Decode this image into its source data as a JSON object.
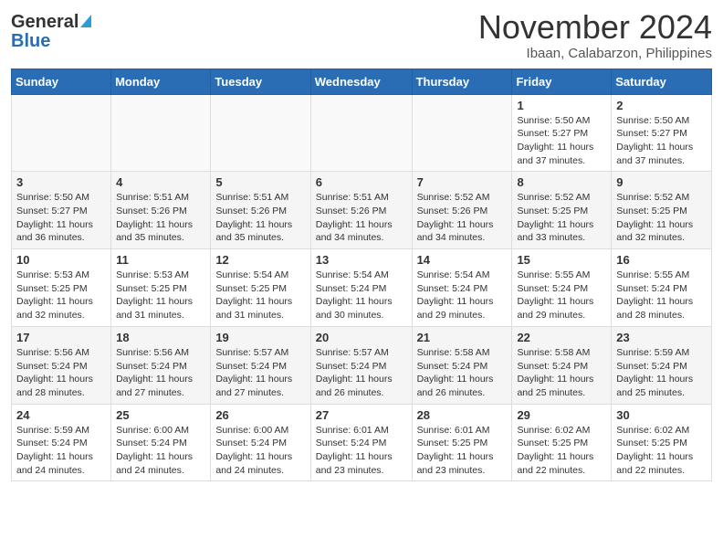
{
  "header": {
    "logo_general": "General",
    "logo_blue": "Blue",
    "month_title": "November 2024",
    "location": "Ibaan, Calabarzon, Philippines"
  },
  "weekdays": [
    "Sunday",
    "Monday",
    "Tuesday",
    "Wednesday",
    "Thursday",
    "Friday",
    "Saturday"
  ],
  "weeks": [
    [
      {
        "day": "",
        "info": ""
      },
      {
        "day": "",
        "info": ""
      },
      {
        "day": "",
        "info": ""
      },
      {
        "day": "",
        "info": ""
      },
      {
        "day": "",
        "info": ""
      },
      {
        "day": "1",
        "info": "Sunrise: 5:50 AM\nSunset: 5:27 PM\nDaylight: 11 hours\nand 37 minutes."
      },
      {
        "day": "2",
        "info": "Sunrise: 5:50 AM\nSunset: 5:27 PM\nDaylight: 11 hours\nand 37 minutes."
      }
    ],
    [
      {
        "day": "3",
        "info": "Sunrise: 5:50 AM\nSunset: 5:27 PM\nDaylight: 11 hours\nand 36 minutes."
      },
      {
        "day": "4",
        "info": "Sunrise: 5:51 AM\nSunset: 5:26 PM\nDaylight: 11 hours\nand 35 minutes."
      },
      {
        "day": "5",
        "info": "Sunrise: 5:51 AM\nSunset: 5:26 PM\nDaylight: 11 hours\nand 35 minutes."
      },
      {
        "day": "6",
        "info": "Sunrise: 5:51 AM\nSunset: 5:26 PM\nDaylight: 11 hours\nand 34 minutes."
      },
      {
        "day": "7",
        "info": "Sunrise: 5:52 AM\nSunset: 5:26 PM\nDaylight: 11 hours\nand 34 minutes."
      },
      {
        "day": "8",
        "info": "Sunrise: 5:52 AM\nSunset: 5:25 PM\nDaylight: 11 hours\nand 33 minutes."
      },
      {
        "day": "9",
        "info": "Sunrise: 5:52 AM\nSunset: 5:25 PM\nDaylight: 11 hours\nand 32 minutes."
      }
    ],
    [
      {
        "day": "10",
        "info": "Sunrise: 5:53 AM\nSunset: 5:25 PM\nDaylight: 11 hours\nand 32 minutes."
      },
      {
        "day": "11",
        "info": "Sunrise: 5:53 AM\nSunset: 5:25 PM\nDaylight: 11 hours\nand 31 minutes."
      },
      {
        "day": "12",
        "info": "Sunrise: 5:54 AM\nSunset: 5:25 PM\nDaylight: 11 hours\nand 31 minutes."
      },
      {
        "day": "13",
        "info": "Sunrise: 5:54 AM\nSunset: 5:24 PM\nDaylight: 11 hours\nand 30 minutes."
      },
      {
        "day": "14",
        "info": "Sunrise: 5:54 AM\nSunset: 5:24 PM\nDaylight: 11 hours\nand 29 minutes."
      },
      {
        "day": "15",
        "info": "Sunrise: 5:55 AM\nSunset: 5:24 PM\nDaylight: 11 hours\nand 29 minutes."
      },
      {
        "day": "16",
        "info": "Sunrise: 5:55 AM\nSunset: 5:24 PM\nDaylight: 11 hours\nand 28 minutes."
      }
    ],
    [
      {
        "day": "17",
        "info": "Sunrise: 5:56 AM\nSunset: 5:24 PM\nDaylight: 11 hours\nand 28 minutes."
      },
      {
        "day": "18",
        "info": "Sunrise: 5:56 AM\nSunset: 5:24 PM\nDaylight: 11 hours\nand 27 minutes."
      },
      {
        "day": "19",
        "info": "Sunrise: 5:57 AM\nSunset: 5:24 PM\nDaylight: 11 hours\nand 27 minutes."
      },
      {
        "day": "20",
        "info": "Sunrise: 5:57 AM\nSunset: 5:24 PM\nDaylight: 11 hours\nand 26 minutes."
      },
      {
        "day": "21",
        "info": "Sunrise: 5:58 AM\nSunset: 5:24 PM\nDaylight: 11 hours\nand 26 minutes."
      },
      {
        "day": "22",
        "info": "Sunrise: 5:58 AM\nSunset: 5:24 PM\nDaylight: 11 hours\nand 25 minutes."
      },
      {
        "day": "23",
        "info": "Sunrise: 5:59 AM\nSunset: 5:24 PM\nDaylight: 11 hours\nand 25 minutes."
      }
    ],
    [
      {
        "day": "24",
        "info": "Sunrise: 5:59 AM\nSunset: 5:24 PM\nDaylight: 11 hours\nand 24 minutes."
      },
      {
        "day": "25",
        "info": "Sunrise: 6:00 AM\nSunset: 5:24 PM\nDaylight: 11 hours\nand 24 minutes."
      },
      {
        "day": "26",
        "info": "Sunrise: 6:00 AM\nSunset: 5:24 PM\nDaylight: 11 hours\nand 24 minutes."
      },
      {
        "day": "27",
        "info": "Sunrise: 6:01 AM\nSunset: 5:24 PM\nDaylight: 11 hours\nand 23 minutes."
      },
      {
        "day": "28",
        "info": "Sunrise: 6:01 AM\nSunset: 5:25 PM\nDaylight: 11 hours\nand 23 minutes."
      },
      {
        "day": "29",
        "info": "Sunrise: 6:02 AM\nSunset: 5:25 PM\nDaylight: 11 hours\nand 22 minutes."
      },
      {
        "day": "30",
        "info": "Sunrise: 6:02 AM\nSunset: 5:25 PM\nDaylight: 11 hours\nand 22 minutes."
      }
    ]
  ]
}
